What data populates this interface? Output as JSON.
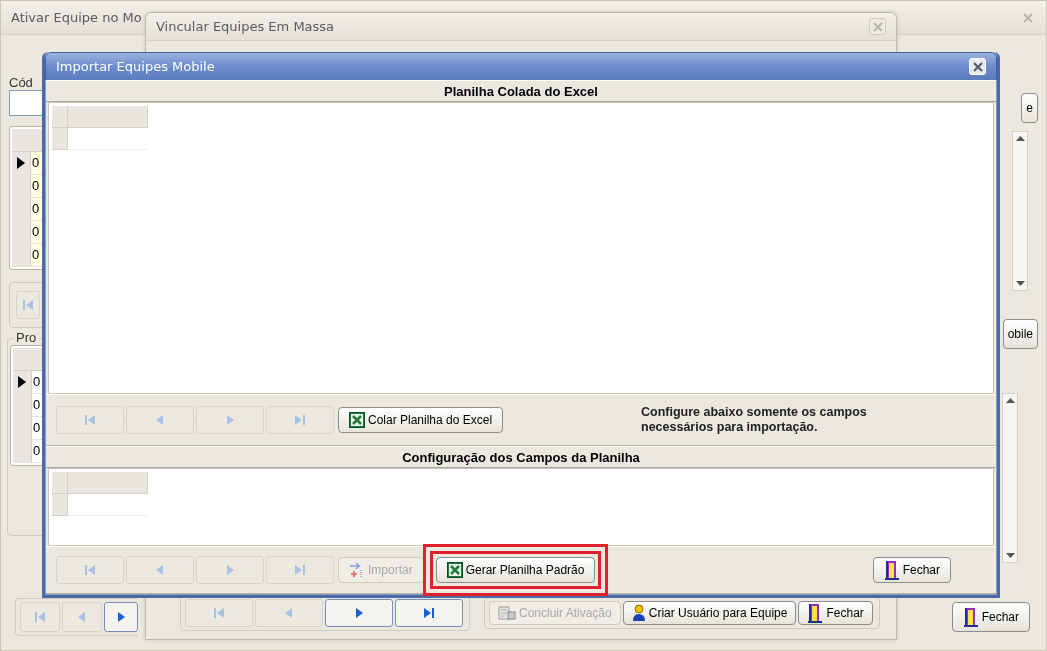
{
  "back_window": {
    "title": "Ativar Equipe no Mo",
    "code_label": "Cód",
    "grid_rows": [
      {
        "cell": "0",
        "selected": true
      },
      {
        "cell": "0",
        "selected": false
      },
      {
        "cell": "0",
        "selected": false
      },
      {
        "cell": "0",
        "selected": false
      },
      {
        "cell": "0",
        "selected": false
      }
    ],
    "products_label": "Pro",
    "products_rows": [
      {
        "cell": "0",
        "selected": true
      },
      {
        "cell": "0",
        "selected": false
      },
      {
        "cell": "0",
        "selected": false
      },
      {
        "cell": "0",
        "selected": false
      }
    ],
    "side_nav_buttons": [
      {
        "kind": "first",
        "disabled": true
      }
    ],
    "right_buttons": [
      "e",
      "obile"
    ],
    "nav_buttons": [
      {
        "kind": "first",
        "disabled": true
      },
      {
        "kind": "prev",
        "disabled": true
      },
      {
        "kind": "next",
        "disabled": false
      }
    ],
    "close_button": "Fechar"
  },
  "middle_window": {
    "title": "Vincular Equipes Em Massa",
    "nav_buttons": [
      {
        "kind": "first",
        "disabled": true
      },
      {
        "kind": "prev",
        "disabled": true
      },
      {
        "kind": "next",
        "disabled": false
      },
      {
        "kind": "last",
        "disabled": false
      }
    ],
    "actions": [
      {
        "kind": "complete",
        "label": "Concluir Ativação",
        "disabled": true
      },
      {
        "kind": "user",
        "label": "Criar Usuário para Equipe",
        "disabled": false
      },
      {
        "kind": "close",
        "label": "Fechar",
        "disabled": false
      }
    ]
  },
  "dialog": {
    "title": "Importar Equipes Mobile",
    "pasted_sheet": {
      "title": "Planilha Colada do Excel",
      "nav_buttons": [
        {
          "kind": "first",
          "disabled": true
        },
        {
          "kind": "prev",
          "disabled": true
        },
        {
          "kind": "next",
          "disabled": true
        },
        {
          "kind": "last",
          "disabled": true
        }
      ],
      "paste_button": "Colar Planilha do Excel",
      "hint": "Configure abaixo somente os campos necessários para importação."
    },
    "field_config": {
      "title": "Configuração dos Campos da Planilha",
      "nav_buttons": [
        {
          "kind": "first",
          "disabled": true
        },
        {
          "kind": "prev",
          "disabled": true
        },
        {
          "kind": "next",
          "disabled": true
        },
        {
          "kind": "last",
          "disabled": true
        }
      ],
      "import_button": {
        "label": "Importar",
        "disabled": true
      },
      "template_button": {
        "label": "Gerar Planilha Padrão",
        "highlighted": true
      },
      "close_button": "Fechar"
    }
  }
}
